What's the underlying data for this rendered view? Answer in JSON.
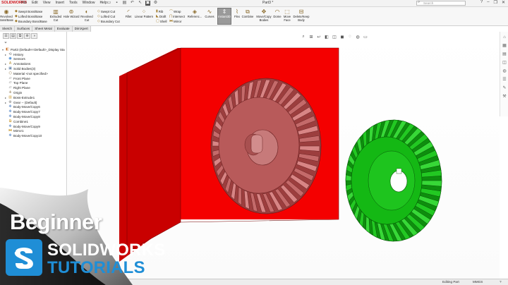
{
  "app": {
    "logo_text": "SOLIDWORKS",
    "document_title": "Part3 *",
    "search_placeholder": "Search"
  },
  "menu": [
    "File",
    "Edit",
    "View",
    "Insert",
    "Tools",
    "Window",
    "Help"
  ],
  "toolbar": {
    "large": [
      {
        "label": "Revolved\nBoss/Base",
        "icon": "revolve-icon"
      },
      {
        "label": "Extruded\nCut",
        "icon": "extruded-cut-icon"
      },
      {
        "label": "Hole Wizard",
        "icon": "hole-wizard-icon"
      },
      {
        "label": "Revolved\nCut",
        "icon": "revolved-cut-icon"
      },
      {
        "label": "Fillet",
        "icon": "fillet-icon"
      },
      {
        "label": "Linear Pattern",
        "icon": "linear-pattern-icon"
      },
      {
        "label": "Referenc...",
        "icon": "reference-icon"
      },
      {
        "label": "Curves",
        "icon": "curves-icon"
      },
      {
        "label": "Instant3D",
        "icon": "instant3d-icon"
      },
      {
        "label": "Flex",
        "icon": "flex-icon"
      },
      {
        "label": "Combine",
        "icon": "combine-icon"
      },
      {
        "label": "Move/Copy\nBodies",
        "icon": "move-copy-icon"
      },
      {
        "label": "Dome",
        "icon": "dome-icon"
      },
      {
        "label": "Move\nFace",
        "icon": "move-face-icon"
      },
      {
        "label": "Delete/Keep\nBody",
        "icon": "delete-keep-icon"
      }
    ],
    "small": {
      "swept_boss": "Swept Boss/Base",
      "lofted_boss": "Lofted Boss/Base",
      "boundary_boss": "Boundary Boss/Base",
      "swept_cut": "Swept Cut",
      "lofted_cut": "Lofted Cut",
      "boundary_cut": "Boundary Cut",
      "rib": "Rib",
      "draft": "Draft",
      "shell": "Shell",
      "wrap": "Wrap",
      "intersect": "Intersect",
      "mirror": "Mirror"
    }
  },
  "tabs": [
    "Sketch",
    "Surfaces",
    "Sheet Metal",
    "Evaluate",
    "DimXpert"
  ],
  "active_tab": "Features",
  "feature_tree": [
    {
      "label": "Part3  (Default<<Default>_Display Sta",
      "icon": "part-icon",
      "expand": "▾"
    },
    {
      "label": "History",
      "icon": "history-icon",
      "expand": "▸"
    },
    {
      "label": "Sensors",
      "icon": "sensor-icon",
      "expand": ""
    },
    {
      "label": "Annotations",
      "icon": "annotation-icon",
      "expand": "▸"
    },
    {
      "label": "Solid Bodies(3)",
      "icon": "solid-bodies-icon",
      "expand": "▸"
    },
    {
      "label": "Material <not specified>",
      "icon": "material-icon",
      "expand": ""
    },
    {
      "label": "Front Plane",
      "icon": "plane-icon",
      "expand": ""
    },
    {
      "label": "Top Plane",
      "icon": "plane-icon",
      "expand": ""
    },
    {
      "label": "Right Plane",
      "icon": "plane-icon",
      "expand": ""
    },
    {
      "label": "Origin",
      "icon": "origin-icon",
      "expand": ""
    },
    {
      "label": "Boss-Extrude1",
      "icon": "extrude-icon",
      "expand": "▸"
    },
    {
      "label": "Gear -- (Default)",
      "icon": "gear-icon",
      "expand": "▸"
    },
    {
      "label": "Body-Move/Copy6",
      "icon": "move-copy-icon",
      "expand": ""
    },
    {
      "label": "Body-Move/Copy7",
      "icon": "move-copy-icon",
      "expand": ""
    },
    {
      "label": "Body-Move/Copy8",
      "icon": "move-copy-icon",
      "expand": ""
    },
    {
      "label": "Combine1",
      "icon": "combine-icon",
      "expand": ""
    },
    {
      "label": "Body-Move/Copy9",
      "icon": "move-copy-icon",
      "expand": ""
    },
    {
      "label": "Mirror1",
      "icon": "mirror-icon",
      "expand": ""
    },
    {
      "label": "Body-Move/Copy10",
      "icon": "move-copy-icon",
      "expand": ""
    }
  ],
  "status": {
    "mode": "Editing Part",
    "units": "MMGS"
  },
  "branding": {
    "line1": "Beginner",
    "line2": "SOLIDWORKS",
    "line3": "TUTORIALS"
  },
  "colors": {
    "block": "#ff1a1a",
    "block_front": "#f40000",
    "block_side": "#c90000",
    "block_top": "#ff4a4a",
    "gear_cut": "#b85a5a",
    "gear_green": "#14b814",
    "accent_blue": "#1f8ed6"
  }
}
